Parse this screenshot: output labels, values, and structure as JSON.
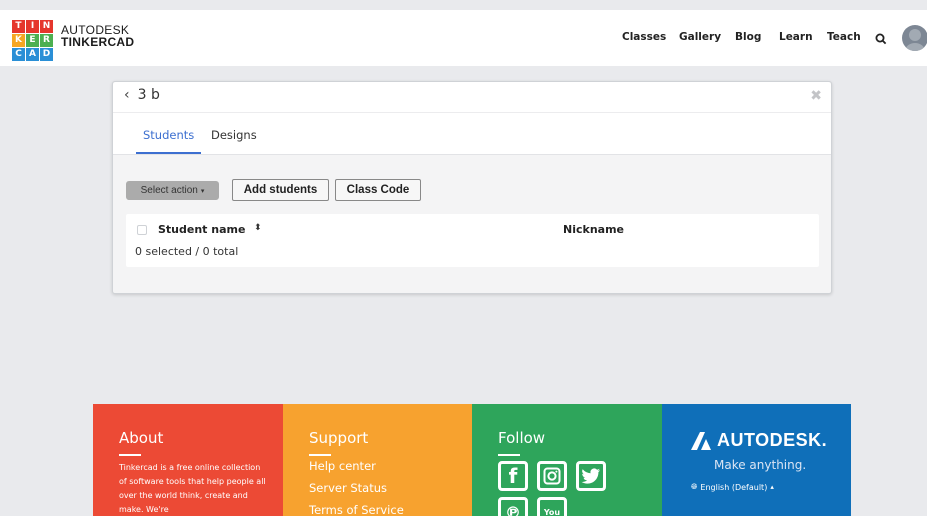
{
  "header": {
    "logo_letters": [
      "T",
      "I",
      "N",
      "K",
      "E",
      "R",
      "C",
      "A",
      "D"
    ],
    "brand_top": "AUTODESK",
    "brand_bottom": "TINKERCAD",
    "nav": [
      "Classes",
      "Gallery",
      "Blog",
      "Learn",
      "Teach"
    ],
    "search_icon": "search-icon",
    "avatar_icon": "user-avatar"
  },
  "card": {
    "back_icon": "chevron-left-icon",
    "class_name": "3 b",
    "close_icon": "close-icon",
    "tabs": [
      "Students",
      "Designs"
    ],
    "active_tab": "Students",
    "select_action": "Select action",
    "add_students": "Add students",
    "class_code": "Class Code",
    "table": {
      "col_student": "Student name",
      "col_nickname": "Nickname",
      "count": "0 selected / 0 total"
    }
  },
  "footer": {
    "about": {
      "title": "About",
      "text": "Tinkercad is a free online collection of software tools that help people all over the world think, create and make. We're"
    },
    "support": {
      "title": "Support",
      "links": [
        "Help center",
        "Server Status",
        "Terms of Service"
      ]
    },
    "follow": {
      "title": "Follow",
      "icons": [
        "facebook-icon",
        "instagram-icon",
        "twitter-icon",
        "pinterest-icon",
        "youtube-icon"
      ],
      "youtube_text": "You"
    },
    "autodesk": {
      "name": "AUTODESK.",
      "tagline": "Make anything.",
      "language": "English (Default)"
    }
  },
  "colors": {
    "about": "#ec4a35",
    "support": "#f7a22f",
    "follow": "#2ea55b",
    "autodesk": "#0f6fb9",
    "accent": "#3c6fd0"
  }
}
